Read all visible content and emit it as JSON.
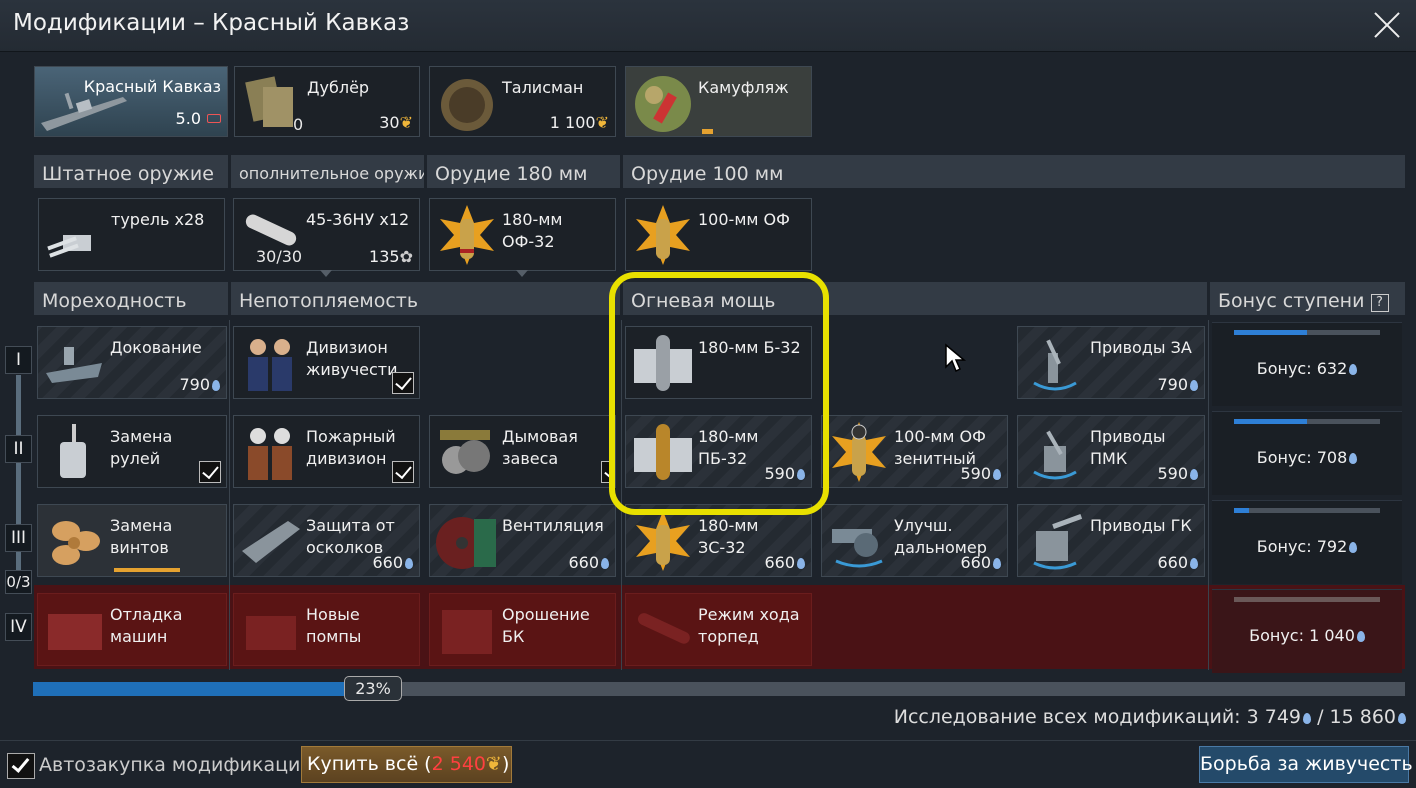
{
  "window": {
    "title": "Модификации – Красный Кавказ"
  },
  "top": {
    "vehicle_name": "Красный Кавказ",
    "vehicle_br": "5.0",
    "crew_name": "Дублёр",
    "crew_count": "0",
    "crew_cost": "30",
    "talisman_name": "Талисман",
    "talisman_cost": "1 100",
    "camo_name": "Камуфляж",
    "camo_progress": 0.1
  },
  "headers": {
    "standard": "Штатное оружие",
    "additional": "ополнительное оружие",
    "gun180": "Орудие 180 мм",
    "gun100": "Орудие 100 мм",
    "seaworthiness": "Мореходность",
    "survivability": "Непотопляемость",
    "firepower": "Огневая мощь",
    "tier_bonus": "Бонус ступени"
  },
  "weapons": {
    "turret": "турель x28",
    "torpedo": "45-36НУ x12",
    "torpedo_ammo": "30/30",
    "torpedo_cost": "135",
    "shell180": "180-мм\nОФ-32",
    "shell100": "100-мм ОФ"
  },
  "tiers": [
    "I",
    "II",
    "III",
    "IV"
  ],
  "tier_counter": "0/3",
  "mods": {
    "docking": {
      "label": "Докование",
      "cost": "790"
    },
    "dc_div": {
      "label": "Дивизион\nживучести"
    },
    "b32": {
      "label": "180-мм Б-32"
    },
    "aa_drives": {
      "label": "Приводы ЗА",
      "cost": "790"
    },
    "rudder": {
      "label": "Замена\nрулей"
    },
    "fire_div": {
      "label": "Пожарный\nдивизион"
    },
    "smoke": {
      "label": "Дымовая\nзавеса"
    },
    "pb32": {
      "label": "180-мм\nПБ-32",
      "cost": "590"
    },
    "of_aa": {
      "label": "100-мм ОФ\nзенитный",
      "cost": "590"
    },
    "pmk_drives": {
      "label": "Приводы\nПМК",
      "cost": "590"
    },
    "propellers": {
      "label": "Замена\nвинтов",
      "progress": 0.6
    },
    "splinter": {
      "label": "Защита от\nосколков",
      "cost": "660"
    },
    "vent": {
      "label": "Вентиляция",
      "cost": "660"
    },
    "zs32": {
      "label": "180-мм\nЗС-32",
      "cost": "660"
    },
    "rangefinder": {
      "label": "Улучш.\nдальномер",
      "cost": "660"
    },
    "gk_drives": {
      "label": "Приводы ГК",
      "cost": "660"
    },
    "engine": {
      "label": "Отладка\nмашин"
    },
    "pumps": {
      "label": "Новые\nпомпы"
    },
    "ammo_spray": {
      "label": "Орошение БК"
    },
    "torp_mode": {
      "label": "Режим хода\nторпед"
    }
  },
  "bonuses": [
    {
      "label": "Бонус: 632",
      "progress": 0.5
    },
    {
      "label": "Бонус: 708",
      "progress": 0.5
    },
    {
      "label": "Бонус: 792",
      "progress": 0.1
    },
    {
      "label": "Бонус: 1 040",
      "progress": 0
    }
  ],
  "progress": {
    "percent_label": "23%",
    "value": 0.23
  },
  "research": {
    "label": "Исследование всех модификаций: 3 749",
    "slash": "/",
    "total": "15 860"
  },
  "footer": {
    "auto_buy": "Автозакупка модификаций",
    "buy_all_prefix": "Купить всё (",
    "buy_all_cost": "2 540",
    "buy_all_suffix": ")",
    "crew_button": "Борьба за живучесть"
  },
  "colors": {
    "accent_blue": "#2e7fd6",
    "highlight": "#e8e000",
    "locked_red": "#5a1414",
    "eagle": "#f0b63a"
  }
}
